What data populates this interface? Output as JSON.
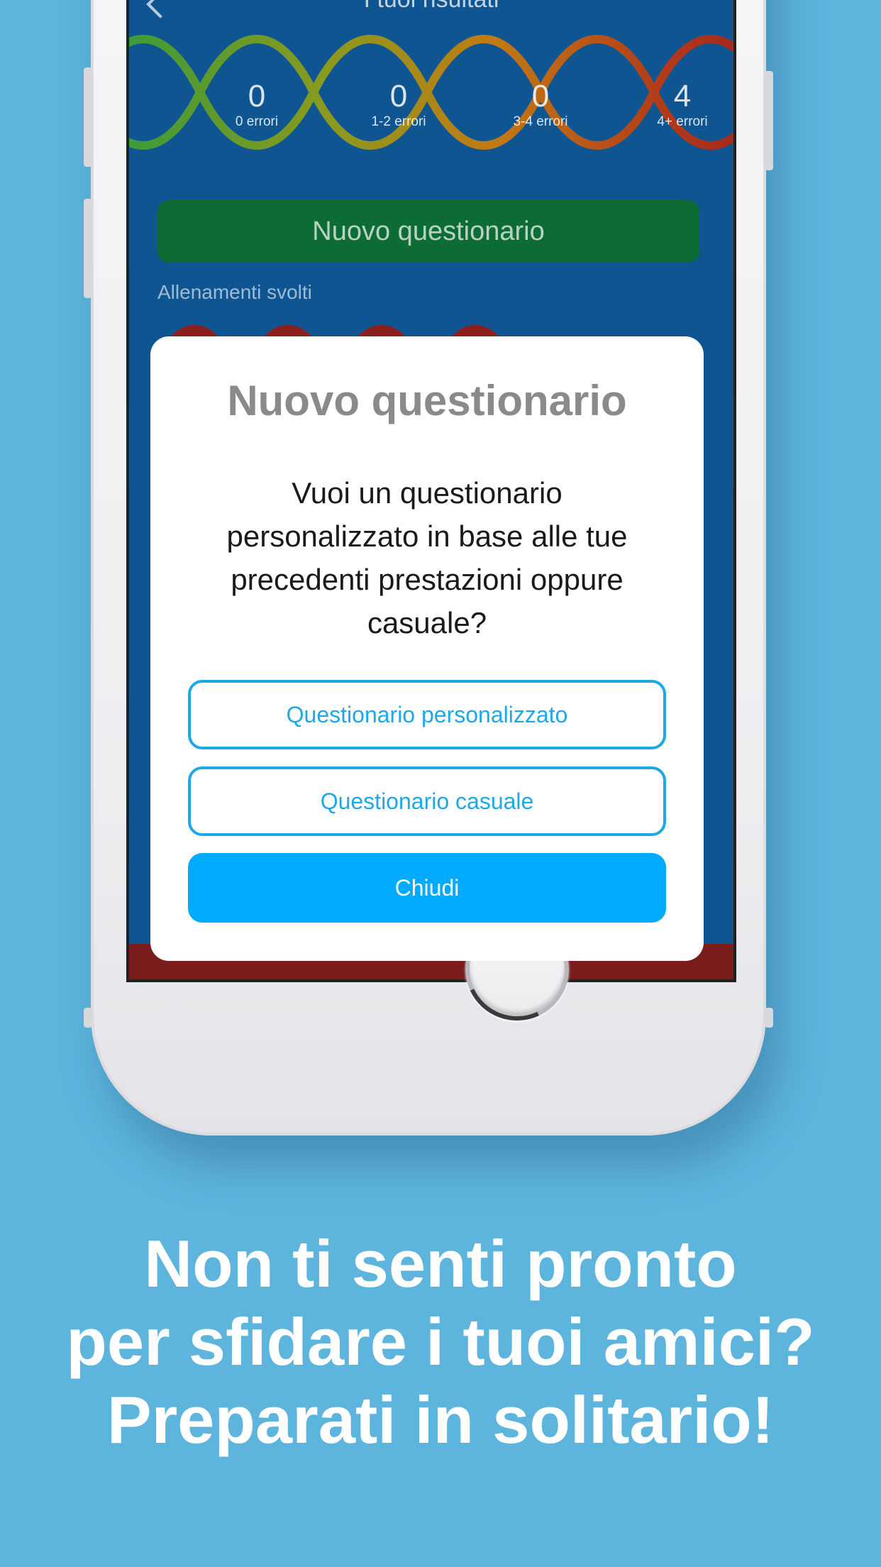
{
  "screen": {
    "nav_title": "I tuoi risultati",
    "stats": [
      {
        "value": "0",
        "label": "0 errori"
      },
      {
        "value": "0",
        "label": "1-2 errori"
      },
      {
        "value": "0",
        "label": "3-4 errori"
      },
      {
        "value": "4",
        "label": "4+ errori"
      }
    ],
    "new_quiz_button": "Nuovo questionario",
    "trainings_label": "Allenamenti svolti"
  },
  "modal": {
    "title": "Nuovo questionario",
    "message": "Vuoi un questionario personalizzato in base alle tue precedenti prestazioni oppure casuale?",
    "buttons": {
      "personalized": "Questionario personalizzato",
      "random": "Questionario casuale",
      "close": "Chiudi"
    }
  },
  "caption": {
    "line1": "Non ti senti pronto",
    "line2": "per sfidare i tuoi amici?",
    "line3": "Preparati in solitario!"
  },
  "colors": {
    "background": "#5db4dd",
    "screen": "#0f5592",
    "green_button": "#0d6b35",
    "accent": "#00aaff",
    "outline": "#1da8e8"
  }
}
